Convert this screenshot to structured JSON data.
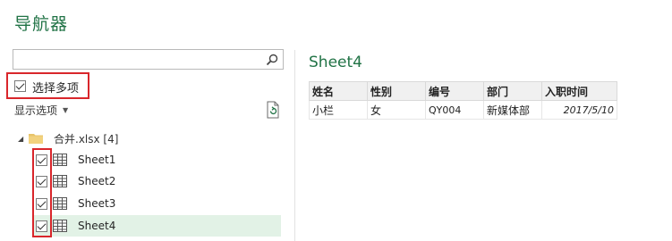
{
  "navigator": {
    "title": "导航器",
    "search": {
      "placeholder": "",
      "value": ""
    },
    "select_multiple": {
      "label": "选择多项",
      "checked": true
    },
    "display_options": {
      "label": "显示选项"
    },
    "tree": {
      "root_label": "合并.xlsx [4]",
      "items": [
        {
          "label": "Sheet1",
          "checked": true,
          "selected": false
        },
        {
          "label": "Sheet2",
          "checked": true,
          "selected": false
        },
        {
          "label": "Sheet3",
          "checked": true,
          "selected": false
        },
        {
          "label": "Sheet4",
          "checked": true,
          "selected": true
        }
      ]
    }
  },
  "preview": {
    "title": "Sheet4",
    "columns": [
      "姓名",
      "性别",
      "编号",
      "部门",
      "入职时间"
    ],
    "rows": [
      [
        "小栏",
        "女",
        "QY004",
        "新媒体部",
        "2017/5/10"
      ]
    ]
  },
  "colors": {
    "accent_green": "#217346",
    "highlight_red": "#d9262b",
    "selected_row": "#e2f2e6"
  }
}
